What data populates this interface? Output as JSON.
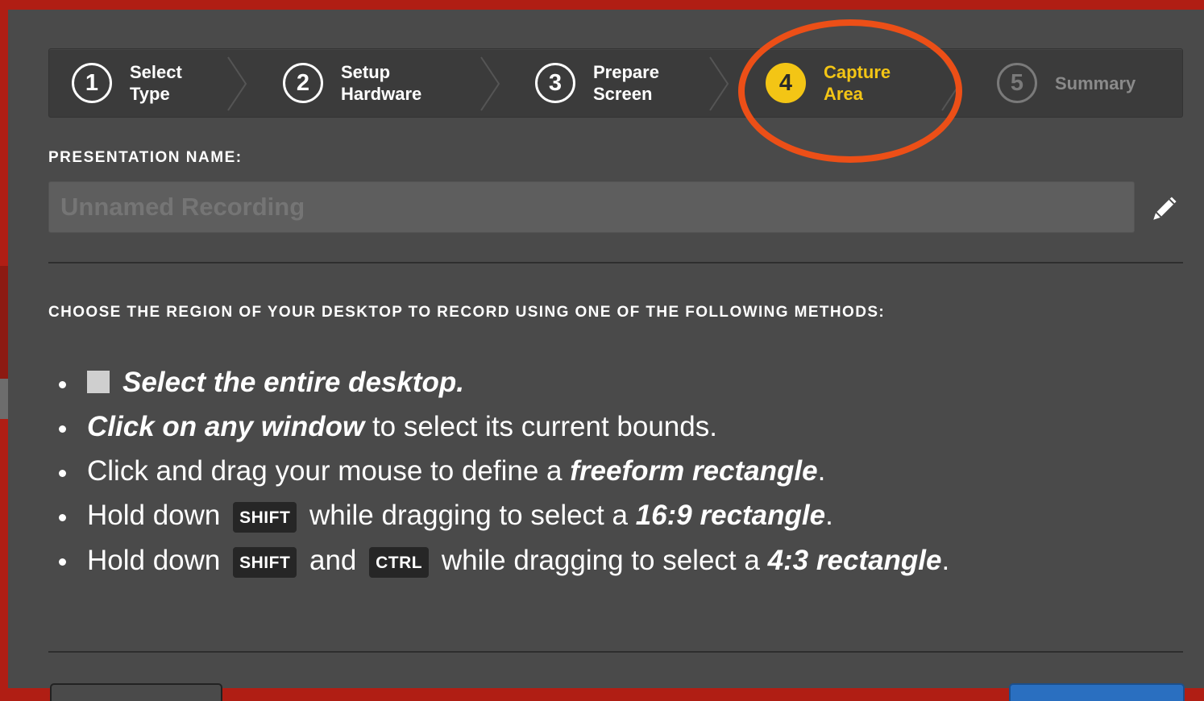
{
  "steps": [
    {
      "number": "1",
      "line1": "Select",
      "line2": "Type",
      "state": "done"
    },
    {
      "number": "2",
      "line1": "Setup",
      "line2": "Hardware",
      "state": "done"
    },
    {
      "number": "3",
      "line1": "Prepare",
      "line2": "Screen",
      "state": "done"
    },
    {
      "number": "4",
      "line1": "Capture",
      "line2": "Area",
      "state": "active"
    },
    {
      "number": "5",
      "line1": "Summary",
      "line2": "",
      "state": "disabled"
    }
  ],
  "presentation": {
    "label": "PRESENTATION NAME:",
    "placeholder": "Unnamed Recording",
    "edit_icon": "pencil-icon"
  },
  "instructions": {
    "heading": "CHOOSE THE REGION OF YOUR DESKTOP TO RECORD USING ONE OF THE FOLLOWING METHODS:",
    "m1": "Select the entire desktop.",
    "m2_em": "Click on any window",
    "m2_rest": " to select its current bounds.",
    "m3_a": "Click and drag your mouse to define a ",
    "m3_em": "freeform rectangle",
    "m3_end": ".",
    "m4_a": "Hold down ",
    "m4_key": "SHIFT",
    "m4_b": " while dragging to select a ",
    "m4_em": "16:9 rectangle",
    "m4_end": ".",
    "m5_a": "Hold down ",
    "m5_key1": "SHIFT",
    "m5_b": " and ",
    "m5_key2": "CTRL",
    "m5_c": " while dragging to select a ",
    "m5_em": "4:3 rectangle",
    "m5_end": "."
  },
  "colors": {
    "active_step": "#f3c515",
    "highlight": "#ec4f17",
    "panel": "#4a4a4a",
    "frame": "#b01e14"
  }
}
